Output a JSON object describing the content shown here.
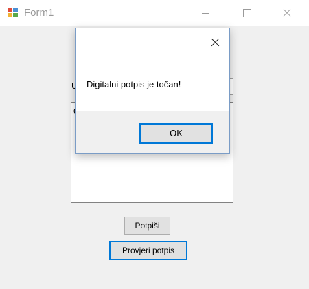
{
  "window": {
    "title": "Form1",
    "icon": "winforms-app-icon",
    "buttons": [
      "minimize-icon",
      "maximize-icon",
      "close-icon"
    ]
  },
  "form": {
    "label": "U",
    "textarea_text": "c",
    "sign_button": "Potpiši",
    "verify_button": "Provjeri potpis"
  },
  "dialog": {
    "message": "Digitalni potpis je točan!",
    "ok_button": "OK",
    "close_icon": "close-icon"
  },
  "colors": {
    "accent": "#0078d7",
    "button_face": "#e1e1e1",
    "window_bg": "#f0f0f0"
  }
}
